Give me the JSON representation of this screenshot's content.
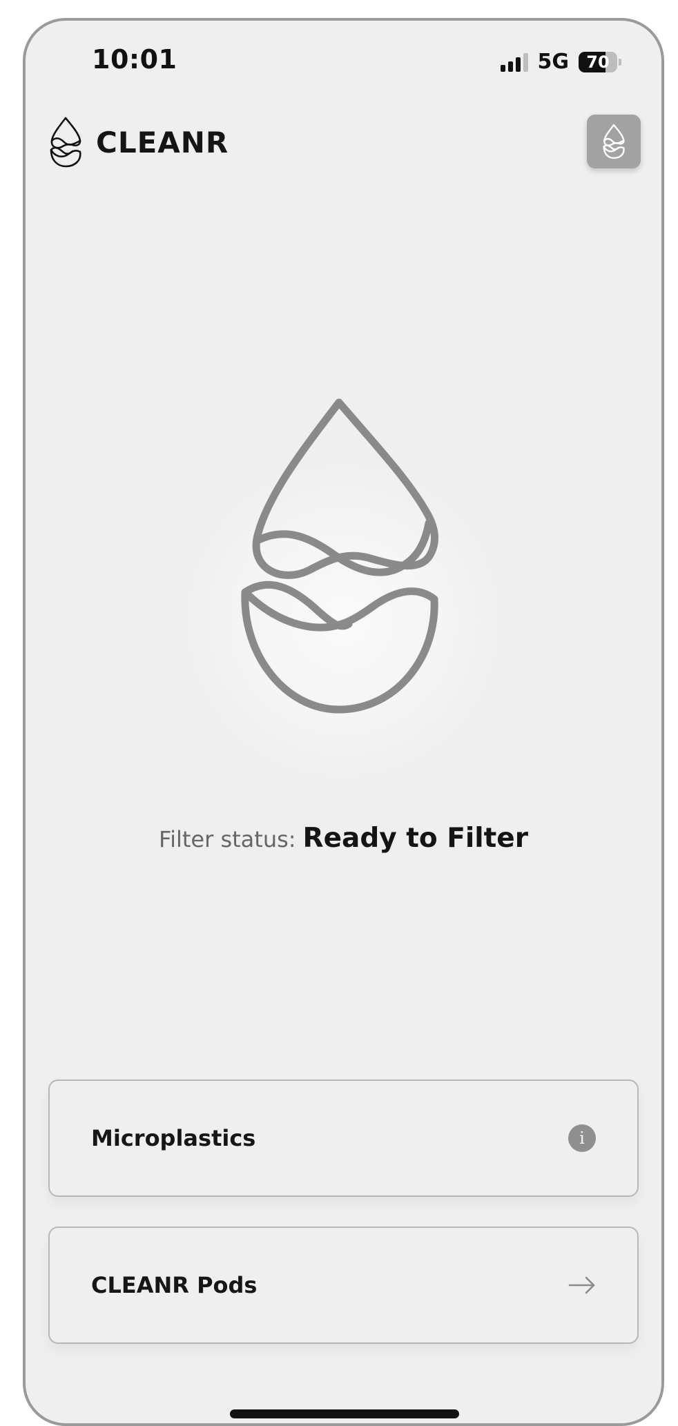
{
  "status_bar": {
    "time": "10:01",
    "network": "5G",
    "battery_level": 70,
    "battery_text": "70"
  },
  "header": {
    "app_title": "CLEANR",
    "logo_icon": "water-drop-logo-icon",
    "button_icon": "water-drop-icon"
  },
  "hero": {
    "icon": "water-drop-logo-icon",
    "filter_status_label": "Filter status:",
    "filter_status_value": "Ready to Filter"
  },
  "cards": [
    {
      "label": "Microplastics",
      "icon": "info-icon"
    },
    {
      "label": "CLEANR Pods",
      "icon": "arrow-right-icon"
    }
  ],
  "colors": {
    "background": "#efefef",
    "frame": "#9a9a9a",
    "icon_stroke": "#8a8a8a",
    "header_button": "#a2a2a2",
    "card_border": "#b7b7b7"
  }
}
